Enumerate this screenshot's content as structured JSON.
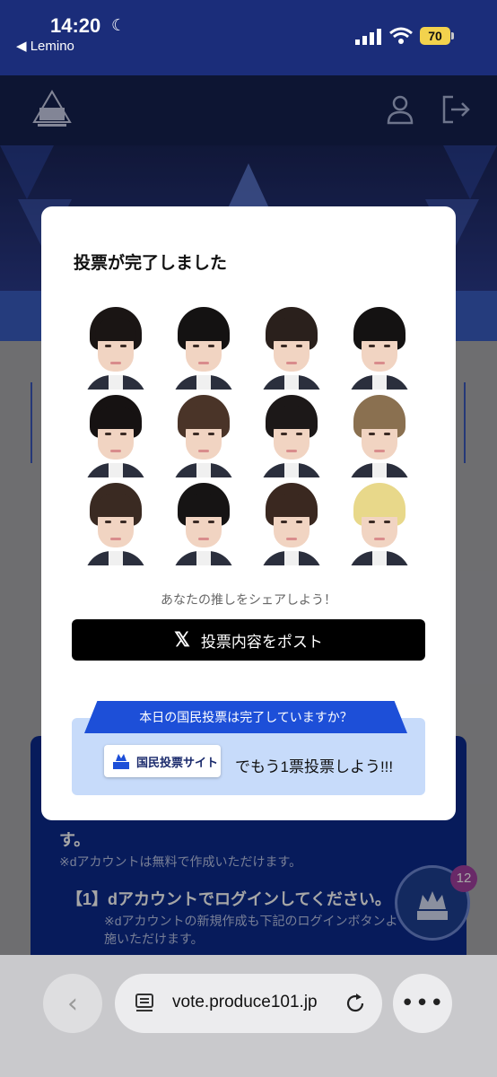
{
  "status_bar": {
    "time": "14:20",
    "back_app": "◀ Lemino",
    "battery": "70"
  },
  "background": {
    "line1": "す。",
    "line2": "※dアカウントは無料で作成いただけます。",
    "line3": "【1】dアカウントでログインしてください。",
    "line4": "※dアカウントの新規作成も下記のログインボタンよ",
    "line5": "施いただけます。",
    "badge_count": "12"
  },
  "modal": {
    "title": "投票が完了しました",
    "share_text": "あなたの推しをシェアしよう！",
    "post_button": "投票内容をポスト",
    "vote_question": "本日の国民投票は完了していますか？",
    "vote_site_button": "国民投票サイト",
    "vote_cta": "でもう1票投票しよう!!!"
  },
  "photos": [
    {
      "hair": "#1a1514"
    },
    {
      "hair": "#141212"
    },
    {
      "hair": "#2a201c"
    },
    {
      "hair": "#141212"
    },
    {
      "hair": "#161212"
    },
    {
      "hair": "#4a3428"
    },
    {
      "hair": "#1c1818"
    },
    {
      "hair": "#8a7050"
    },
    {
      "hair": "#3a2a22"
    },
    {
      "hair": "#161414"
    },
    {
      "hair": "#3a2820"
    },
    {
      "hair": "#e8d88a"
    }
  ],
  "browser": {
    "url": "vote.produce101.jp"
  },
  "colors": {
    "accent": "#1d4fd8",
    "header": "#14214f"
  }
}
